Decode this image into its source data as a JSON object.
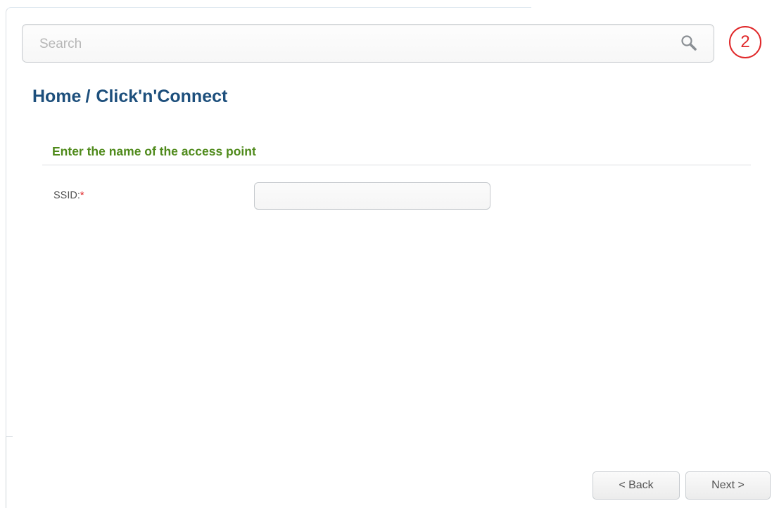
{
  "search": {
    "placeholder": "Search",
    "value": ""
  },
  "badge": {
    "value": "2",
    "color": "#e0282a"
  },
  "breadcrumb": {
    "home": "Home",
    "separator": "/",
    "current": "Click'n'Connect"
  },
  "section": {
    "title": "Enter the name of the access point"
  },
  "form": {
    "ssid_label": "SSID:",
    "required_marker": "*",
    "ssid_value": ""
  },
  "buttons": {
    "back_label": "< Back",
    "next_label": "Next >"
  },
  "colors": {
    "breadcrumb": "#1d4f7c",
    "section_title": "#4f8a1b",
    "required": "#e0282a"
  },
  "icons": {
    "search": "search-icon"
  }
}
